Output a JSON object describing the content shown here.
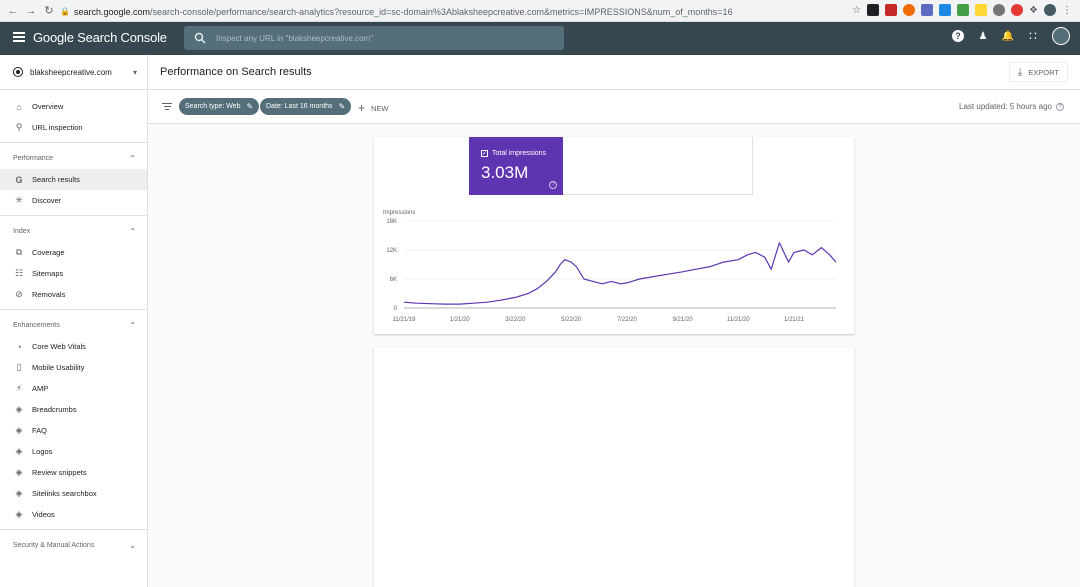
{
  "browser": {
    "url_host": "search.google.com",
    "url_path": "/search-console/performance/search-analytics?resource_id=sc-domain%3Ablaksheepcreative.com&metrics=IMPRESSIONS&num_of_months=16"
  },
  "header": {
    "brand": "Google Search Console",
    "search_placeholder": "Inspect any URL in \"blaksheepcreative.com\""
  },
  "sidebar": {
    "property": "blaksheepcreative.com",
    "top_items": [
      {
        "label": "Overview",
        "icon": "home-icon"
      },
      {
        "label": "URL inspection",
        "icon": "search-icon"
      }
    ],
    "sections": [
      {
        "title": "Performance",
        "items": [
          {
            "label": "Search results",
            "icon": "google-g-icon",
            "active": true
          },
          {
            "label": "Discover",
            "icon": "asterisk-icon"
          }
        ]
      },
      {
        "title": "Index",
        "items": [
          {
            "label": "Coverage",
            "icon": "file-copy-icon"
          },
          {
            "label": "Sitemaps",
            "icon": "sitemap-icon"
          },
          {
            "label": "Removals",
            "icon": "visibility-off-icon"
          }
        ]
      },
      {
        "title": "Enhancements",
        "items": [
          {
            "label": "Core Web Vitals",
            "icon": "gauge-icon"
          },
          {
            "label": "Mobile Usability",
            "icon": "phone-icon"
          },
          {
            "label": "AMP",
            "icon": "bolt-icon"
          },
          {
            "label": "Breadcrumbs",
            "icon": "layers-icon"
          },
          {
            "label": "FAQ",
            "icon": "layers-icon"
          },
          {
            "label": "Logos",
            "icon": "layers-icon"
          },
          {
            "label": "Review snippets",
            "icon": "layers-icon"
          },
          {
            "label": "Sitelinks searchbox",
            "icon": "layers-icon"
          },
          {
            "label": "Videos",
            "icon": "layers-icon"
          }
        ]
      }
    ],
    "bottom_section": "Security & Manual Actions"
  },
  "main": {
    "page_title": "Performance on Search results",
    "export_label": "EXPORT",
    "chips": [
      "Search type: Web",
      "Date: Last 16 months"
    ],
    "new_label": "NEW",
    "last_updated": "Last updated: 5 hours ago",
    "metric": {
      "label": "Total impressions",
      "value": "3.03M",
      "color": "#5e35b1"
    }
  },
  "chart_data": {
    "type": "line",
    "title": "",
    "ylabel": "Impressions",
    "xlabel": "",
    "ylim": [
      0,
      18000
    ],
    "yticks": [
      "18K",
      "12K",
      "6K",
      "0"
    ],
    "xticks": [
      "11/21/19",
      "1/21/20",
      "3/22/20",
      "5/22/20",
      "7/22/20",
      "9/21/20",
      "11/21/20",
      "1/21/21"
    ],
    "x": [
      "2019-11-21",
      "2019-12-05",
      "2019-12-20",
      "2020-01-05",
      "2020-01-21",
      "2020-02-05",
      "2020-02-20",
      "2020-03-05",
      "2020-03-22",
      "2020-04-05",
      "2020-04-15",
      "2020-04-25",
      "2020-05-05",
      "2020-05-10",
      "2020-05-15",
      "2020-05-22",
      "2020-05-28",
      "2020-06-05",
      "2020-06-15",
      "2020-06-25",
      "2020-07-05",
      "2020-07-15",
      "2020-07-22",
      "2020-08-05",
      "2020-08-20",
      "2020-09-05",
      "2020-09-21",
      "2020-10-05",
      "2020-10-20",
      "2020-11-05",
      "2020-11-21",
      "2020-12-01",
      "2020-12-10",
      "2020-12-20",
      "2020-12-27",
      "2021-01-05",
      "2021-01-15",
      "2021-01-21",
      "2021-02-01",
      "2021-02-10",
      "2021-02-20",
      "2021-03-01",
      "2021-03-08"
    ],
    "y": [
      1200,
      1000,
      900,
      800,
      800,
      1000,
      1200,
      1600,
      2200,
      3000,
      4000,
      5500,
      7500,
      9000,
      10000,
      9500,
      8500,
      6000,
      5500,
      5000,
      5500,
      5000,
      5200,
      6000,
      6500,
      7000,
      7500,
      8000,
      8500,
      9500,
      10000,
      11000,
      11500,
      10500,
      8000,
      13500,
      9500,
      11500,
      12000,
      11000,
      12500,
      11000,
      9500
    ],
    "line_color": "#5e35b1"
  }
}
